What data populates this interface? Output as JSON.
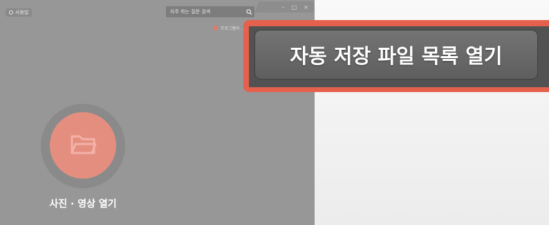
{
  "titlebar": {
    "signin_label": "사용법",
    "search_placeholder": "자주 하는 질문 검색",
    "window_controls": [
      "–",
      "□",
      "×"
    ]
  },
  "program_item_label": "프로그램이 ...",
  "main": {
    "open_label": "사진 · 영상 열기"
  },
  "callout": {
    "button_label": "자동 저장 파일 목록 열기"
  },
  "colors": {
    "accent": "#e5604d",
    "circle": "#e48e80",
    "app_bg": "#979797"
  }
}
